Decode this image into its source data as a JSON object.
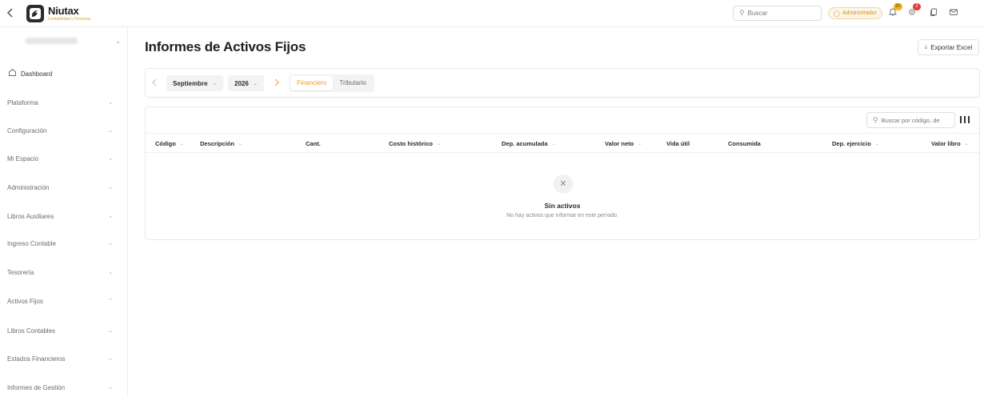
{
  "topbar": {
    "back_icon": "chevron-left-icon",
    "logo_name": "Niutax",
    "logo_sub": "Contabilidad y Finanzas",
    "search_placeholder": "Buscar",
    "role_badge": "Administrador",
    "notifications_count": "30",
    "alerts_count": "2"
  },
  "sidebar": {
    "company_name": "",
    "dashboard": "Dashboard",
    "items": [
      "Plataforma",
      "Configuración",
      "Mi Espacio",
      "Administración",
      "Libros Auxiliares",
      "Ingreso Contable",
      "Tesorería",
      "Activos Fijos",
      "Libros Contables",
      "Estados Financieros",
      "Informes de Gestión"
    ],
    "expanded_item": "Activos Fijos"
  },
  "main": {
    "title": "Informes de Activos Fijos",
    "export_label": "Exportar Excel",
    "filters": {
      "month": "Septiembre",
      "year": "2026",
      "tabs": [
        "Financiero",
        "Tributario"
      ],
      "active_tab": "Financiero"
    },
    "table": {
      "search_placeholder": "Buscar por código, de",
      "columns": [
        "Código",
        "Descripción",
        "Cant.",
        "Costo histórico",
        "Dep. acumulada",
        "Valor neto",
        "Vida útil",
        "Consumida",
        "Dep. ejercicio",
        "Valor libro"
      ],
      "empty_title": "Sin activos",
      "empty_text": "No hay activos que informar en este período."
    }
  },
  "colors": {
    "accent": "#e99a3a",
    "badge_yellow": "#f2b51d",
    "badge_red": "#e53935"
  }
}
